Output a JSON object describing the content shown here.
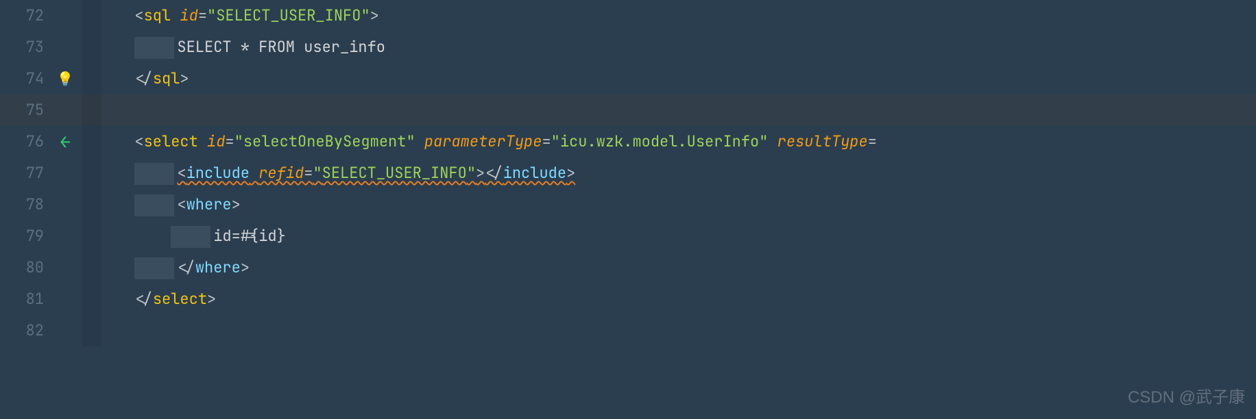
{
  "gutter": {
    "lines": [
      "72",
      "73",
      "74",
      "75",
      "76",
      "77",
      "78",
      "79",
      "80",
      "81",
      "82"
    ],
    "bulb_line": "74",
    "arrow_line": "76"
  },
  "code": {
    "l72": {
      "tag_open": "<",
      "tag": "sql",
      "sp": " ",
      "attr": "id",
      "eq": "=",
      "q1": "\"",
      "val": "SELECT_USER_INFO",
      "q2": "\"",
      "tag_close": ">"
    },
    "l73": {
      "text": "SELECT * FROM user_info"
    },
    "l74": {
      "tag_open": "</",
      "tag": "sql",
      "tag_close": ">"
    },
    "l76": {
      "tag_open": "<",
      "tag": "select",
      "sp1": " ",
      "attr1": "id",
      "eq1": "=",
      "q1a": "\"",
      "val1": "selectOneBySegment",
      "q1b": "\"",
      "sp2": " ",
      "attr2": "parameterType",
      "eq2": "=",
      "q2a": "\"",
      "val2": "icu.wzk.model.UserInfo",
      "q2b": "\"",
      "sp3": " ",
      "attr3": "resultType",
      "eq3": "="
    },
    "l77": {
      "tag_open": "<",
      "tag": "include",
      "sp": " ",
      "attr": "refid",
      "eq": "=",
      "q1": "\"",
      "val": "SELECT_USER_INFO",
      "q2": "\"",
      "tag_close": ">",
      "close_open": "</",
      "close_tag": "include",
      "close_close": ">"
    },
    "l78": {
      "tag_open": "<",
      "tag": "where",
      "tag_close": ">"
    },
    "l79": {
      "text": "id=#{id}"
    },
    "l80": {
      "tag_open": "</",
      "tag": "where",
      "tag_close": ">"
    },
    "l81": {
      "tag_open": "</",
      "tag": "select",
      "tag_close": ">"
    }
  },
  "watermark": "CSDN @武子康"
}
